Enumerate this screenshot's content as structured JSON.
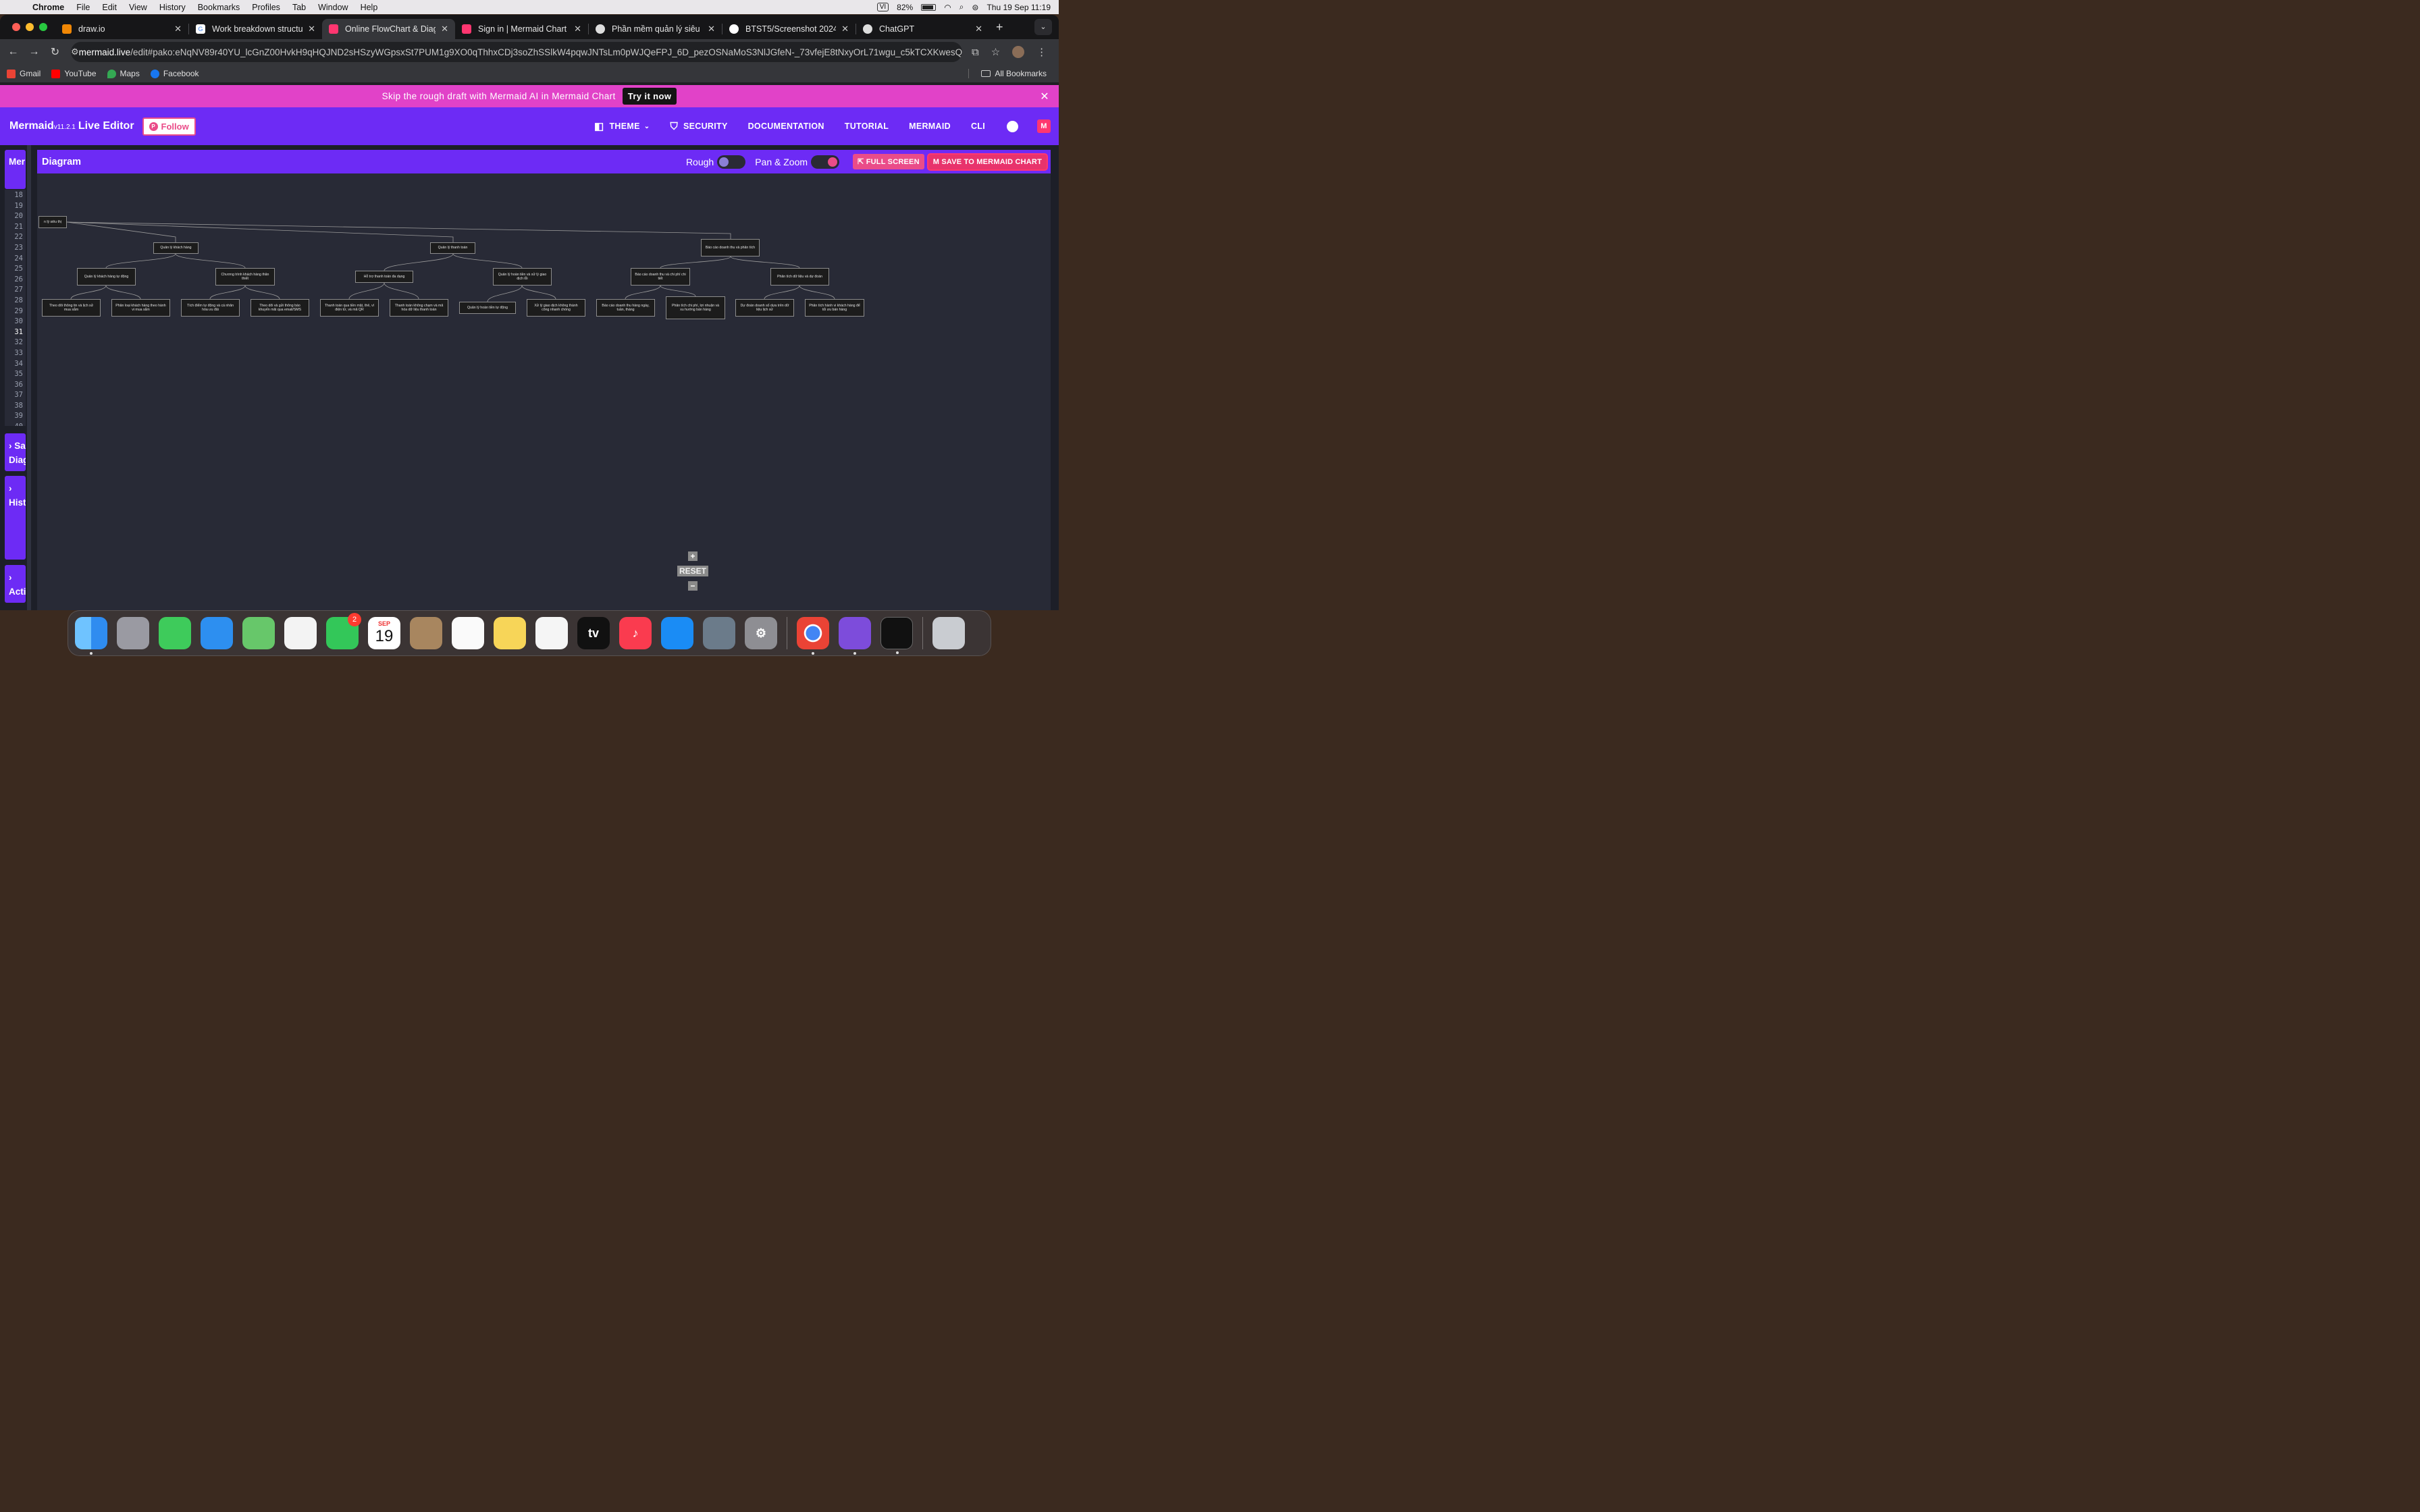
{
  "menubar": {
    "app": "Chrome",
    "items": [
      "File",
      "Edit",
      "View",
      "History",
      "Bookmarks",
      "Profiles",
      "Tab",
      "Window",
      "Help"
    ],
    "input_source": "VI",
    "battery": "82%",
    "datetime": "Thu 19 Sep  11:19"
  },
  "tabs": [
    {
      "title": "draw.io",
      "color": "#f08705"
    },
    {
      "title": "Work breakdown structure",
      "color": "#4285f4"
    },
    {
      "title": "Online FlowChart & Diagram",
      "color": "#ff3670"
    },
    {
      "title": "Sign in | Mermaid Chart",
      "color": "#ff3670"
    },
    {
      "title": "Phần mềm quản lý siêu thị",
      "color": "#555"
    },
    {
      "title": "BTST5/Screenshot 2024-0",
      "color": "#333"
    },
    {
      "title": "ChatGPT",
      "color": "#555"
    }
  ],
  "address": {
    "host": "mermaid.live",
    "path": "/edit#pako:eNqNV89r40YU_lcGnZ00HvkH9qHQJND2sHSzyWGpsxSt7PUM1g9XO0qThhxCDj3soZhSSlkW4pqwJNTsLm0pWJQeFPJ_6D_pezOSNaMoS3NlJGfeN-_73vfejE8tNxyOrL71wgu_c5kTCXKwesQ-Pls"
  },
  "bookmarks": [
    "Gmail",
    "YouTube",
    "Maps",
    "Facebook"
  ],
  "all_bookmarks": "All Bookmarks",
  "promo": {
    "text": "Skip the rough draft with Mermaid AI in Mermaid Chart",
    "button": "Try it now"
  },
  "header": {
    "brand": "Mermaid",
    "version": "v11.2.1",
    "subtitle": "Live Editor",
    "follow": "Follow",
    "nav": [
      "THEME",
      "SECURITY",
      "DOCUMENTATION",
      "TUTORIAL",
      "MERMAID",
      "CLI"
    ]
  },
  "side_panels": {
    "code": "Mer",
    "sample": "Sa",
    "sample2": "Diag",
    "history": "Hist",
    "actions": "Acti"
  },
  "editor": {
    "line_numbers": [
      "18",
      "19",
      "20",
      "21",
      "22",
      "23",
      "24",
      "25",
      "26",
      "27",
      "28",
      "29",
      "30",
      "31",
      "32",
      "33",
      "34",
      "35",
      "36",
      "37",
      "38",
      "39",
      "40"
    ],
    "current_line": "31"
  },
  "diagram_panel": {
    "title": "Diagram",
    "rough_label": "Rough",
    "rough_on": false,
    "panzoom_label": "Pan & Zoom",
    "panzoom_on": true,
    "fullscreen": "FULL SCREEN",
    "save": "SAVE TO MERMAID CHART"
  },
  "diagram": {
    "root": "n lý siêu thị",
    "level1": [
      "Quản lý khách hàng",
      "Quản lý thanh toán",
      "Báo cáo doanh thu và phân tích"
    ],
    "level2": [
      "Quản lý khách hàng tự động",
      "Chương trình khách hàng thân thiết",
      "Hỗ trợ thanh toán đa dạng",
      "Quản lý hoàn tiền và xử lý giao dịch lỗi",
      "Báo cáo doanh thu và chi phí chi tiết",
      "Phân tích dữ liệu và dự đoán"
    ],
    "level3": [
      "Theo dõi thông tin và lịch sử mua sắm",
      "Phân loại khách hàng theo hành vi mua sắm",
      "Tích điểm tự động và cá nhân hóa ưu đãi",
      "Theo dõi và gửi thông báo khuyến mãi qua email/SMS",
      "Thanh toán qua tiền mặt, thẻ, ví điện tử, và mã QR",
      "Thanh toán không chạm và mã hóa dữ liệu thanh toán",
      "Quản lý hoàn tiền tự động",
      "Xử lý giao dịch không thành công nhanh chóng",
      "Báo cáo doanh thu hàng ngày, tuần, tháng",
      "Phân tích chi phí, lợi nhuận và xu hướng bán hàng",
      "Dự đoán doanh số dựa trên dữ liệu lịch sử",
      "Phân tích hành vi khách hàng để tối ưu bán hàng"
    ]
  },
  "zoom": {
    "plus": "+",
    "reset": "RESET",
    "minus": "−"
  },
  "dock": {
    "facetime_badge": "2",
    "calendar_month": "SEP",
    "calendar_day": "19",
    "tv_label": "tv"
  }
}
